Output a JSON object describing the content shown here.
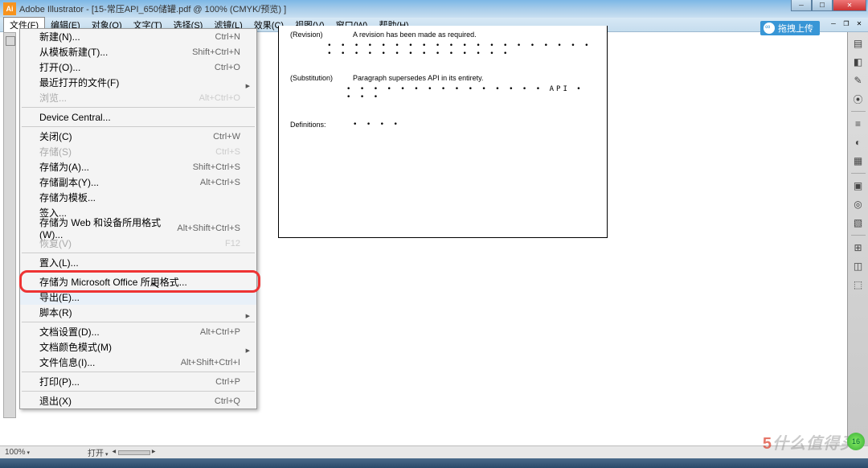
{
  "app_title": "Adobe Illustrator - [15-常压API_650储罐.pdf @ 100% (CMYK/预览) ]",
  "menubar": [
    "文件(F)",
    "编辑(E)",
    "对象(O)",
    "文字(T)",
    "选择(S)",
    "滤镜(L)",
    "效果(C)",
    "视图(V)",
    "窗口(W)",
    "帮助(H)"
  ],
  "sync_label": "拖拽上传",
  "dropdown": [
    {
      "label": "新建(N)...",
      "sc": "Ctrl+N"
    },
    {
      "label": "从模板新建(T)...",
      "sc": "Shift+Ctrl+N"
    },
    {
      "label": "打开(O)...",
      "sc": "Ctrl+O"
    },
    {
      "label": "最近打开的文件(F)",
      "sub": true
    },
    {
      "label": "浏览...",
      "sc": "Alt+Ctrl+O",
      "disabled": true
    },
    {
      "sep": true
    },
    {
      "label": "Device Central..."
    },
    {
      "sep": true
    },
    {
      "label": "关闭(C)",
      "sc": "Ctrl+W"
    },
    {
      "label": "存储(S)",
      "sc": "Ctrl+S",
      "disabled": true
    },
    {
      "label": "存储为(A)...",
      "sc": "Shift+Ctrl+S"
    },
    {
      "label": "存储副本(Y)...",
      "sc": "Alt+Ctrl+S"
    },
    {
      "label": "存储为模板..."
    },
    {
      "label": "签入..."
    },
    {
      "label": "存储为 Web 和设备所用格式(W)...",
      "sc": "Alt+Shift+Ctrl+S"
    },
    {
      "label": "恢复(V)",
      "sc": "F12",
      "disabled": true
    },
    {
      "sep": true
    },
    {
      "label": "置入(L)..."
    },
    {
      "sep": true
    },
    {
      "label": "存储为 Microsoft Office 所用格式..."
    },
    {
      "label": "导出(E)...",
      "hl": true
    },
    {
      "label": "脚本(R)",
      "sub": true
    },
    {
      "sep": true
    },
    {
      "label": "文档设置(D)...",
      "sc": "Alt+Ctrl+P"
    },
    {
      "label": "文档颜色模式(M)",
      "sub": true
    },
    {
      "label": "文件信息(I)...",
      "sc": "Alt+Shift+Ctrl+I"
    },
    {
      "sep": true
    },
    {
      "label": "打印(P)...",
      "sc": "Ctrl+P"
    },
    {
      "sep": true
    },
    {
      "label": "退出(X)",
      "sc": "Ctrl+Q"
    }
  ],
  "doc": {
    "rev_key": "(Revision)",
    "rev_txt": "A revision has been made as required.",
    "dots1": "• • • • • • • • • • • • • • • • • • • • • • • • • • • • • • • • • •",
    "sub_key": "(Substitution)",
    "sub_txt": "Paragraph supersedes API in its entirety.",
    "dots2": "• • • • • • • • • • • • • • • API • • • •",
    "def_key": "Definitions:",
    "def_dots": "• • • •"
  },
  "status": {
    "zoom": "100%",
    "mid": "打开"
  },
  "watermark_text": "什么值得买",
  "badge": "16"
}
